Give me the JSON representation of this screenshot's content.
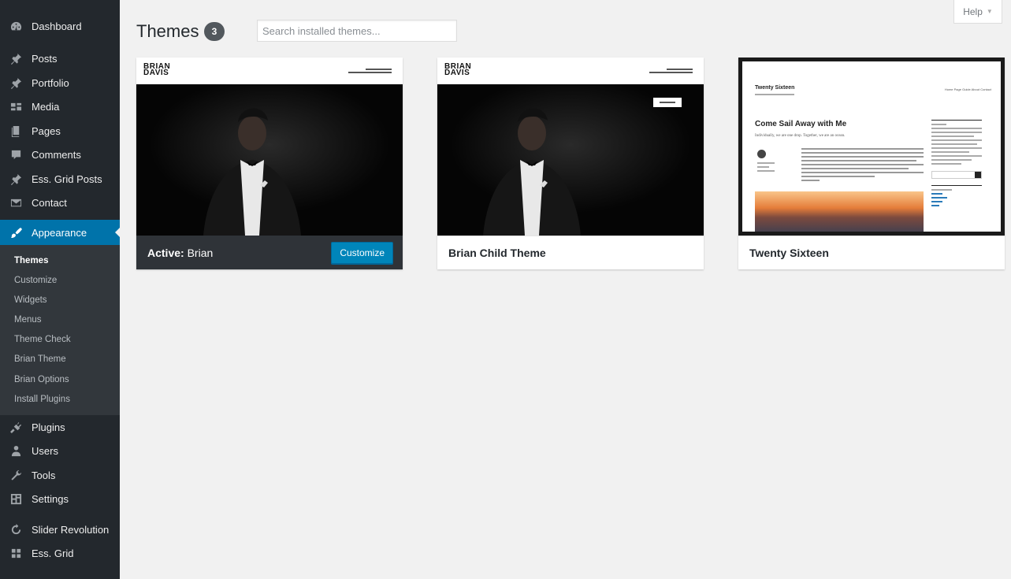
{
  "sidebar": {
    "items": [
      {
        "label": "Dashboard",
        "icon": "dashboard-icon"
      },
      {
        "label": "Posts",
        "icon": "pin-icon"
      },
      {
        "label": "Portfolio",
        "icon": "pin-icon"
      },
      {
        "label": "Media",
        "icon": "media-icon"
      },
      {
        "label": "Pages",
        "icon": "pages-icon"
      },
      {
        "label": "Comments",
        "icon": "comments-icon"
      },
      {
        "label": "Ess. Grid Posts",
        "icon": "pin-icon"
      },
      {
        "label": "Contact",
        "icon": "mail-icon"
      },
      {
        "label": "Appearance",
        "icon": "paintbrush-icon"
      },
      {
        "label": "Plugins",
        "icon": "plugin-icon"
      },
      {
        "label": "Users",
        "icon": "users-icon"
      },
      {
        "label": "Tools",
        "icon": "wrench-icon"
      },
      {
        "label": "Settings",
        "icon": "settings-icon"
      },
      {
        "label": "Slider Revolution",
        "icon": "refresh-icon"
      },
      {
        "label": "Ess. Grid",
        "icon": "grid-icon"
      }
    ],
    "submenu": [
      "Themes",
      "Customize",
      "Widgets",
      "Menus",
      "Theme Check",
      "Brian Theme",
      "Brian Options",
      "Install Plugins"
    ]
  },
  "header": {
    "title": "Themes",
    "count": "3",
    "search_placeholder": "Search installed themes...",
    "help_label": "Help"
  },
  "themes": [
    {
      "active_prefix": "Active:",
      "name": "Brian",
      "customize_label": "Customize",
      "brand": "BRIAN DAVIS",
      "brand_line1": "BRIAN",
      "brand_line2": "DAVIS"
    },
    {
      "name": "Brian Child Theme",
      "brand_line1": "BRIAN",
      "brand_line2": "DAVIS"
    },
    {
      "name": "Twenty Sixteen",
      "preview_site_title": "Twenty Sixteen",
      "preview_post_title": "Come Sail Away with Me",
      "preview_excerpt": "Individually, we are one drop. Together, we are an ocean.",
      "preview_nav": "Home   Page Guide   About   Contact"
    }
  ],
  "colors": {
    "sidebar_bg": "#23282d",
    "accent": "#0073aa",
    "button": "#0085ba",
    "page_bg": "#f1f1f1"
  }
}
